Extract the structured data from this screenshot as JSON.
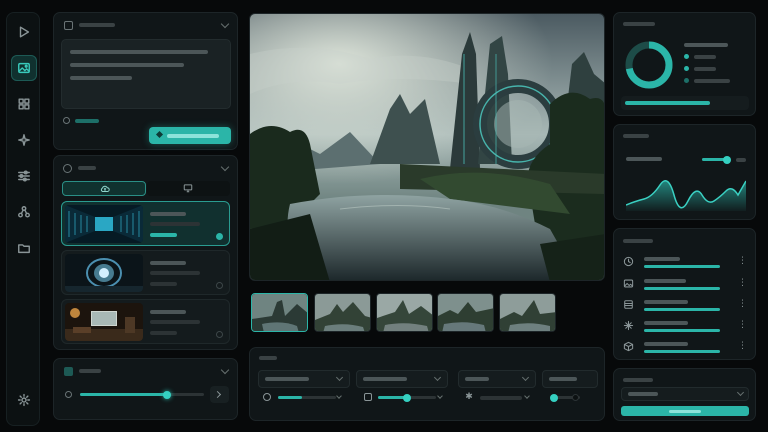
{
  "colors": {
    "background": "#07090a",
    "panel": "#101618",
    "accent": "#2bb5a8",
    "accent_dim": "#1d6f68",
    "skeleton": "#3a4244"
  },
  "rail": {
    "items": [
      {
        "icon": "play-icon",
        "active": false
      },
      {
        "icon": "image-icon",
        "active": true
      },
      {
        "icon": "grid-icon",
        "active": false
      },
      {
        "icon": "sparkles-icon",
        "active": false
      },
      {
        "icon": "sliders-icon",
        "active": false
      },
      {
        "icon": "nodes-icon",
        "active": false
      },
      {
        "icon": "folder-icon",
        "active": false
      }
    ],
    "bottom_icon": "gear-icon"
  },
  "prompt_panel": {
    "icon": "x-box-icon",
    "collapse_icon": "chevron-down-icon",
    "info_icon": "circle-icon"
  },
  "model_panel": {
    "tabs": [
      {
        "icon": "cloud-upload-icon",
        "active": true
      },
      {
        "icon": "monitor-icon",
        "active": false
      }
    ],
    "cards": [
      {
        "theme": "server-corridor",
        "selected": true
      },
      {
        "theme": "portal-room",
        "selected": false
      },
      {
        "theme": "living-room",
        "selected": false
      }
    ]
  },
  "strength_panel": {
    "slider_value": 0.6,
    "next_icon": "chevron-right-icon"
  },
  "viewer": {
    "thumbnails": 5,
    "selected_thumbnail": 0
  },
  "stats_panel": {
    "donut_fraction": 0.72,
    "progress": 0.68
  },
  "chart_panel": {
    "slider_value": 0.85
  },
  "history_panel": {
    "icons": [
      "clock-icon",
      "image-icon",
      "stack-icon",
      "sparkles-icon",
      "cube-icon"
    ],
    "menu_icon": "kebab-icon"
  },
  "bottom_panel": {
    "sliders": [
      0.42,
      0.48,
      0.1
    ]
  }
}
